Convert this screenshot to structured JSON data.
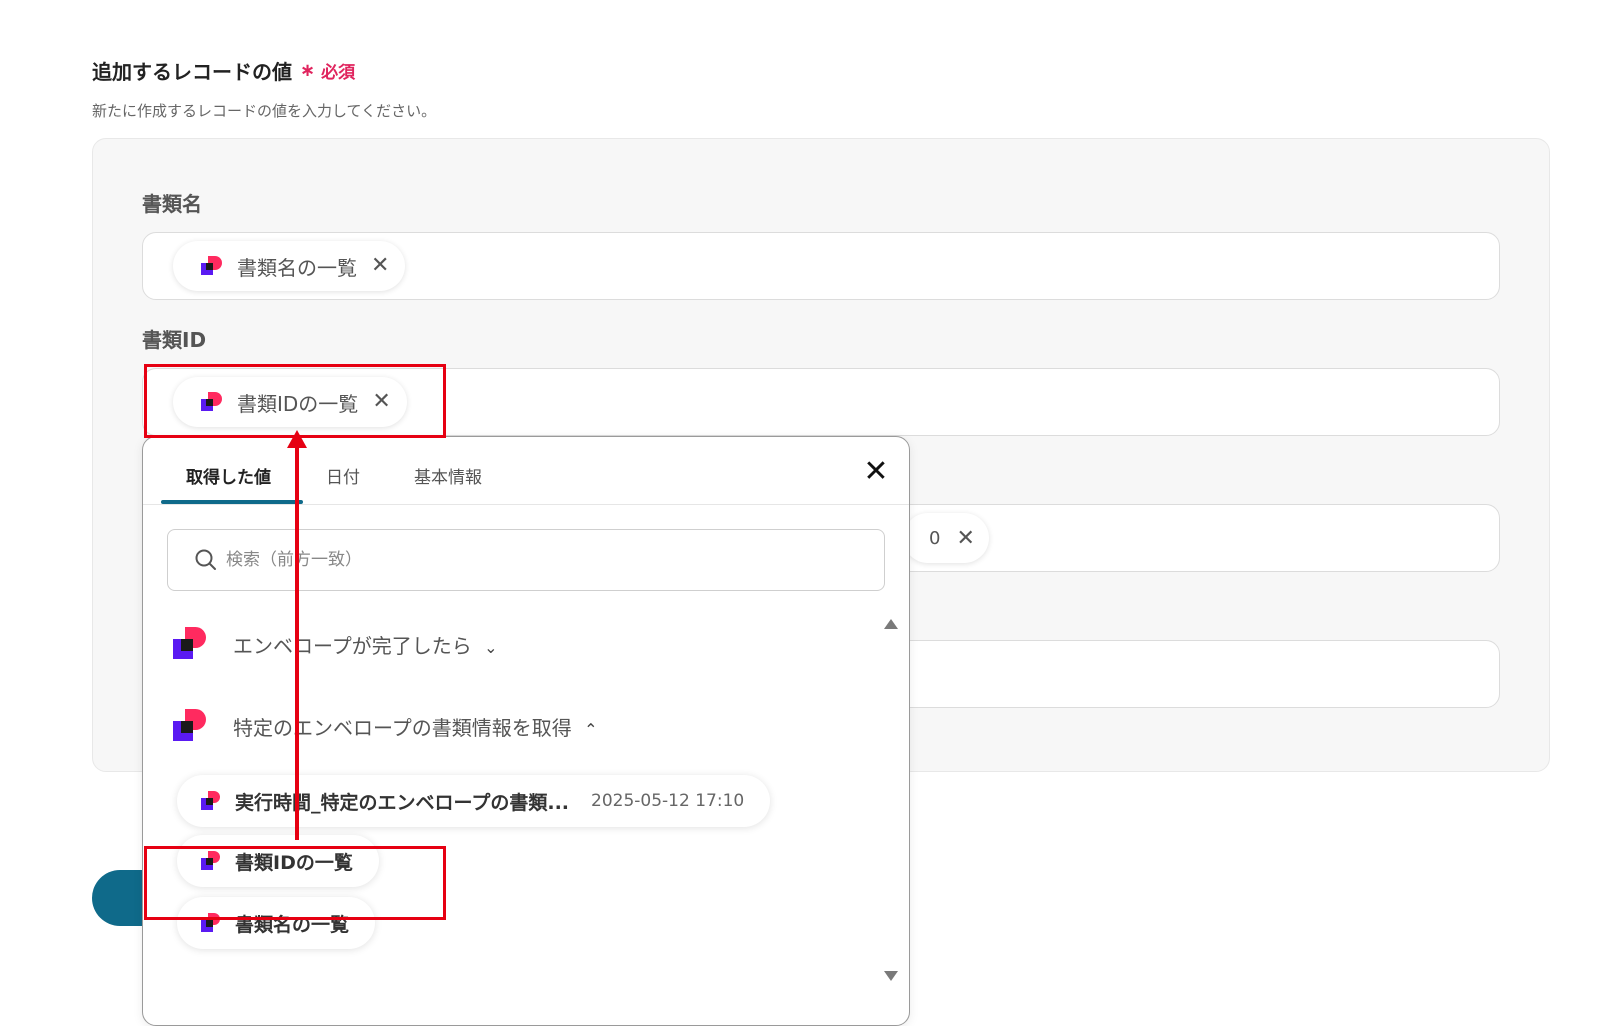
{
  "section": {
    "title": "追加するレコードの値",
    "required_mark": "∗",
    "required_text": "必須",
    "description": "新たに作成するレコードの値を入力してください。"
  },
  "fields": {
    "doc_name": {
      "label": "書類名",
      "chip": "書類名の一覧"
    },
    "doc_id": {
      "label": "書類ID",
      "chip": "書類IDの一覧"
    },
    "hidden_chip_tail": "0"
  },
  "popup": {
    "tabs": [
      "取得した値",
      "日付",
      "基本情報"
    ],
    "active_tab": "取得した値",
    "close_glyph": "✕",
    "search_placeholder": "検索（前方一致）",
    "groups": [
      {
        "label": "エンベロープが完了したら",
        "state": "collapsed"
      },
      {
        "label": "特定のエンベロープの書類情報を取得",
        "state": "expanded"
      }
    ],
    "items": [
      {
        "label": "実行時間_特定のエンベロープの書類...",
        "meta": "2025-05-12 17:10"
      },
      {
        "label": "書類IDの一覧",
        "meta": ""
      },
      {
        "label": "書類名の一覧",
        "meta": ""
      }
    ]
  },
  "glyphs": {
    "remove": "✕",
    "chevron_down": "⌄",
    "chevron_up": "⌃"
  },
  "colors": {
    "accent": "#0f6a8a",
    "required": "#e0245e",
    "annotation": "#e60012",
    "icon_red": "#ff2a5f",
    "icon_purple": "#5a1af2"
  }
}
